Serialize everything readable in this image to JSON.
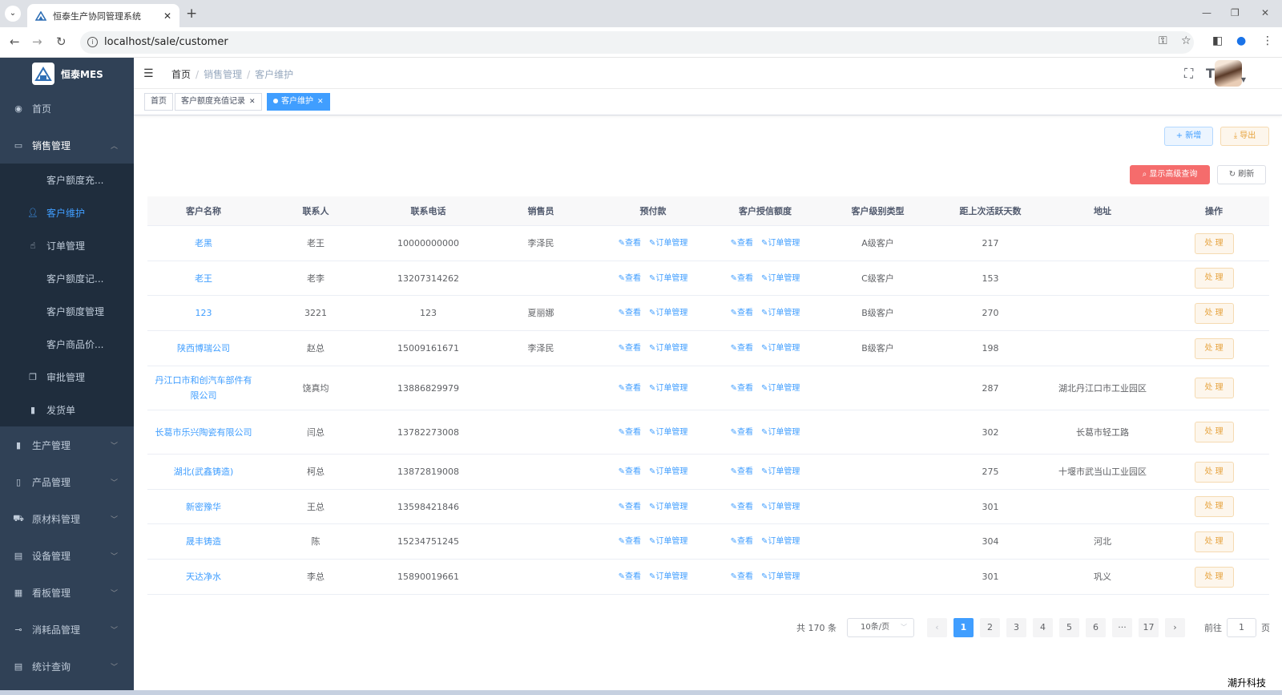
{
  "browser": {
    "tab_title": "恒泰生产协同管理系统",
    "tab_close": "✕",
    "new_tab": "+",
    "url": "localhost/sale/customer"
  },
  "sidebar": {
    "logo_text": "恒泰MES",
    "home": "首页",
    "sales": "销售管理",
    "sales_items": [
      {
        "label": "客户额度充..."
      },
      {
        "label": "客户维护"
      },
      {
        "label": "订单管理"
      },
      {
        "label": "客户额度记..."
      },
      {
        "label": "客户额度管理"
      },
      {
        "label": "客户商品价..."
      },
      {
        "label": "审批管理"
      },
      {
        "label": "发货单"
      }
    ],
    "menus": [
      {
        "label": "生产管理"
      },
      {
        "label": "产品管理"
      },
      {
        "label": "原材料管理"
      },
      {
        "label": "设备管理"
      },
      {
        "label": "看板管理"
      },
      {
        "label": "消耗品管理"
      },
      {
        "label": "统计查询"
      }
    ]
  },
  "topbar": {
    "breadcrumb": [
      "首页",
      "销售管理",
      "客户维护"
    ]
  },
  "tags": [
    {
      "label": "首页"
    },
    {
      "label": "客户额度充值记录"
    },
    {
      "label": "客户维护"
    }
  ],
  "toolbar": {
    "add": "+ 新增",
    "export": "⤓ 导出",
    "advanced": "显示高级查询",
    "refresh": "刷新"
  },
  "table": {
    "headers": [
      "客户名称",
      "联系人",
      "联系电话",
      "销售员",
      "预付款",
      "客户授信额度",
      "客户级别类型",
      "距上次活跃天数",
      "地址",
      "操作"
    ],
    "view_label": "查看",
    "order_label": "订单管理",
    "handle_label": "处 理",
    "rows": [
      {
        "name": "老黑",
        "contact": "老王",
        "phone": "10000000000",
        "sales": "李泽民",
        "level": "A级客户",
        "days": "217",
        "address": ""
      },
      {
        "name": "老王",
        "contact": "老李",
        "phone": "13207314262",
        "sales": "",
        "level": "C级客户",
        "days": "153",
        "address": ""
      },
      {
        "name": "123",
        "contact": "3221",
        "phone": "123",
        "sales": "夏丽娜",
        "level": "B级客户",
        "days": "270",
        "address": ""
      },
      {
        "name": "陕西博瑞公司",
        "contact": "赵总",
        "phone": "15009161671",
        "sales": "李泽民",
        "level": "B级客户",
        "days": "198",
        "address": ""
      },
      {
        "name": "丹江口市和创汽车部件有限公司",
        "contact": "饶真均",
        "phone": "13886829979",
        "sales": "",
        "level": "",
        "days": "287",
        "address": "湖北丹江口市工业园区"
      },
      {
        "name": "长葛市乐兴陶瓷有限公司",
        "contact": "闫总",
        "phone": "13782273008",
        "sales": "",
        "level": "",
        "days": "302",
        "address": "长葛市轻工路"
      },
      {
        "name": "湖北(武鑫铸造)",
        "contact": "柯总",
        "phone": "13872819008",
        "sales": "",
        "level": "",
        "days": "275",
        "address": "十堰市武当山工业园区"
      },
      {
        "name": "新密豫华",
        "contact": "王总",
        "phone": "13598421846",
        "sales": "",
        "level": "",
        "days": "301",
        "address": ""
      },
      {
        "name": "晟丰铸造",
        "contact": "陈",
        "phone": "15234751245",
        "sales": "",
        "level": "",
        "days": "304",
        "address": "河北"
      },
      {
        "name": "天达净水",
        "contact": "李总",
        "phone": "15890019661",
        "sales": "",
        "level": "",
        "days": "301",
        "address": "巩义"
      }
    ]
  },
  "pagination": {
    "total": "共 170 条",
    "page_size": "10条/页",
    "pages": [
      "1",
      "2",
      "3",
      "4",
      "5",
      "6",
      "···",
      "17"
    ],
    "goto_label": "前往",
    "goto_value": "1",
    "page_unit": "页"
  },
  "watermark": "潮升科技"
}
